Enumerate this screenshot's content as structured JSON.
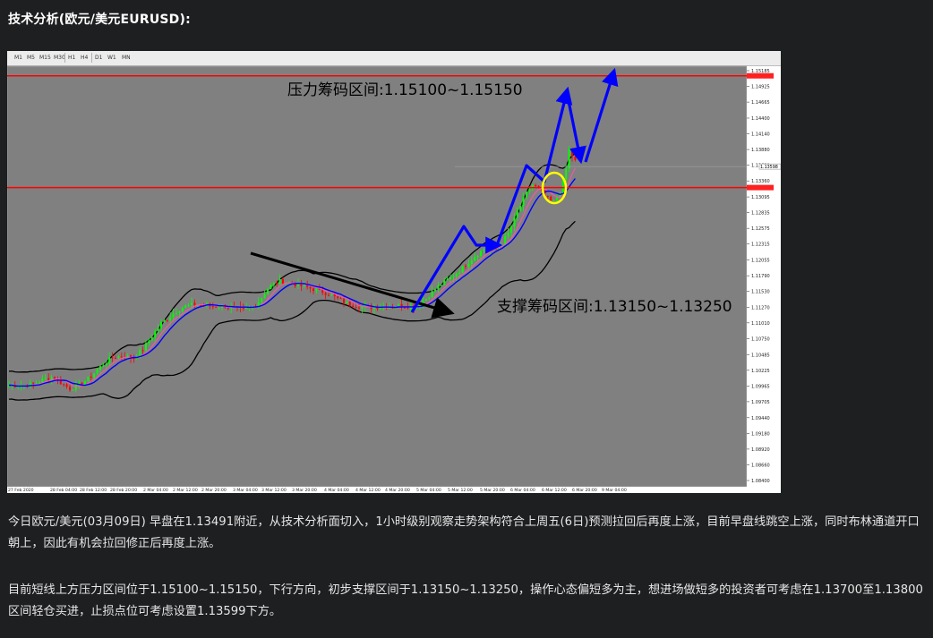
{
  "article": {
    "title": "技术分析(欧元/美元EURUSD):",
    "paragraphs": [
      "今日欧元/美元(03月09日) 早盘在1.13491附近，从技术分析面切入，1小时级别观察走势架构符合上周五(6日)预测拉回后再度上涨，目前早盘线跳空上涨，同时布林通道开口朝上，因此有机会拉回修正后再度上涨。",
      "目前短线上方压力区间位于1.15100~1.15150，下行方向，初步支撑区间于1.13150~1.13250，操作心态偏短多为主，想进场做短多的投资者可考虑在1.13700至1.13800区间轻仓买进，止损点位可考虑设置1.13599下方。"
    ]
  },
  "toolbar": {
    "timeframes": [
      "M1",
      "M5",
      "M15",
      "M30",
      "H1",
      "H4",
      "D1",
      "W1",
      "MN"
    ]
  },
  "chart_data": {
    "type": "candlestick",
    "symbol": "EURUSD",
    "timeframe": "H1",
    "annotations": {
      "resistance_label": "压力筹码区间:1.15100~1.15150",
      "support_label": "支撑筹码区间:1.13150~1.13250"
    },
    "y_ticks": [
      "1.15185",
      "1.14925",
      "1.14665",
      "1.14400",
      "1.14140",
      "1.13880",
      "1.13620",
      "1.13360",
      "1.13095",
      "1.12835",
      "1.12575",
      "1.12315",
      "1.12055",
      "1.11790",
      "1.11530",
      "1.11270",
      "1.11010",
      "1.10750",
      "1.10485",
      "1.10225",
      "1.09965",
      "1.09705",
      "1.09440",
      "1.09180",
      "1.08920",
      "1.08660",
      "1.08400"
    ],
    "price_labels": {
      "current": "1.13598"
    },
    "x_ticks": [
      "27 Feb 2020",
      "28 Feb 04:00",
      "28 Feb 12:00",
      "28 Feb 20:00",
      "2 Mar 04:00",
      "2 Mar 12:00",
      "2 Mar 20:00",
      "3 Mar 04:00",
      "3 Mar 12:00",
      "3 Mar 20:00",
      "4 Mar 04:00",
      "4 Mar 12:00",
      "4 Mar 20:00",
      "5 Mar 04:00",
      "5 Mar 12:00",
      "5 Mar 20:00",
      "6 Mar 04:00",
      "6 Mar 12:00",
      "6 Mar 20:00",
      "9 Mar 04:00"
    ],
    "ylim": [
      1.084,
      1.15185
    ],
    "resistance_level": 1.151,
    "support_level": 1.1325,
    "colors": {
      "background": "#808080",
      "bull": "#00ff00",
      "bear": "#ff0000",
      "ma": "#0000ff",
      "bands": "#000000",
      "levels": "#ff0000"
    }
  }
}
